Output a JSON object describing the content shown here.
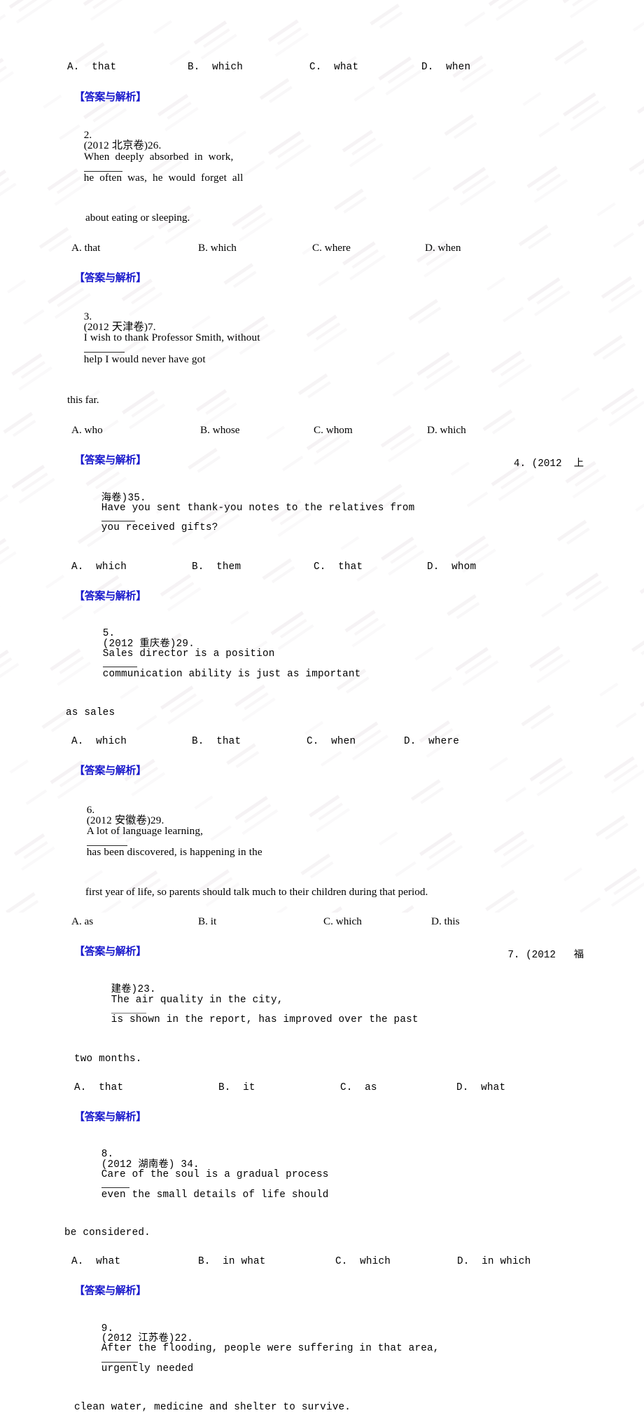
{
  "document": {
    "type": "exam-worksheet-scan",
    "language": "zh-CN/en",
    "answer_header_label": "【答案与解析】",
    "answer_header_color": "#1717CC",
    "page_background": "#ffffff",
    "text_color": "#000000"
  },
  "q1_tail": {
    "options": [
      "A.  that",
      "B.  which",
      "C.  what",
      "D.  when"
    ]
  },
  "q2": {
    "number": "2.",
    "source": "(2012 北京卷)26.",
    "stem_line1_a": "When  deeply  absorbed  in  work,",
    "stem_line1_b": "he  often  was,  he  would  forget  all",
    "stem_line2": "about eating or sleeping.",
    "options": [
      "A. that",
      "B. which",
      "C. where",
      "D. when"
    ]
  },
  "q3": {
    "number": "3.",
    "source": "(2012 天津卷)7.",
    "stem_line1_a": "I wish to thank Professor Smith, without",
    "stem_line1_b": "help I would never have got",
    "stem_line2": "this far.",
    "options": [
      "A. who",
      "B. whose",
      "C. whom",
      "D. which"
    ]
  },
  "q4": {
    "number_overflow": "4. (2012  上",
    "source_tail": "海卷)35.",
    "stem_line1_a": "Have you sent thank-you notes to the relatives from",
    "stem_line1_b": "you received gifts?",
    "options": [
      "A.  which",
      "B.  them",
      "C.  that",
      "D.  whom"
    ]
  },
  "q5": {
    "number": "5.",
    "source": "(2012 重庆卷)29.",
    "stem_line1_a": "Sales director is a position",
    "stem_line1_b": "communication ability is just as important",
    "stem_line2": "as sales",
    "options": [
      "A.  which",
      "B.  that",
      "C.  when",
      "D.  where"
    ]
  },
  "q6": {
    "number": "6.",
    "source": "(2012 安徽卷)29.",
    "stem_line1_a": "A lot of language learning,",
    "stem_line1_b": "has been discovered, is happening in the",
    "stem_line2": "first year of life, so parents should talk much to their children during that period.",
    "options": [
      "A. as",
      "B. it",
      "C. which",
      "D. this"
    ]
  },
  "q7": {
    "number_overflow": "7. (2012   福",
    "source_tail": "建卷)23.",
    "stem_line1_a": "The air quality in the city,",
    "stem_line1_b": "is shown in the report, has improved over the past",
    "stem_line2": "two months.",
    "options": [
      "A.  that",
      "B.  it",
      "C.  as",
      "D.  what"
    ]
  },
  "q8": {
    "number": "8.",
    "source": "(2012 湖南卷) 34.",
    "stem_line1_a": "Care of the soul is a gradual process",
    "stem_line1_b": "even the small details of life should",
    "stem_line2": "be considered.",
    "options": [
      "A.  what",
      "B.  in what",
      "C.  which",
      "D.  in which"
    ]
  },
  "q9": {
    "number": "9.",
    "source": "(2012 江苏卷)22.",
    "stem_line1_a": "After the flooding, people were suffering in that area,",
    "stem_line1_b": "urgently needed",
    "stem_line2": "clean water, medicine and shelter to survive."
  }
}
